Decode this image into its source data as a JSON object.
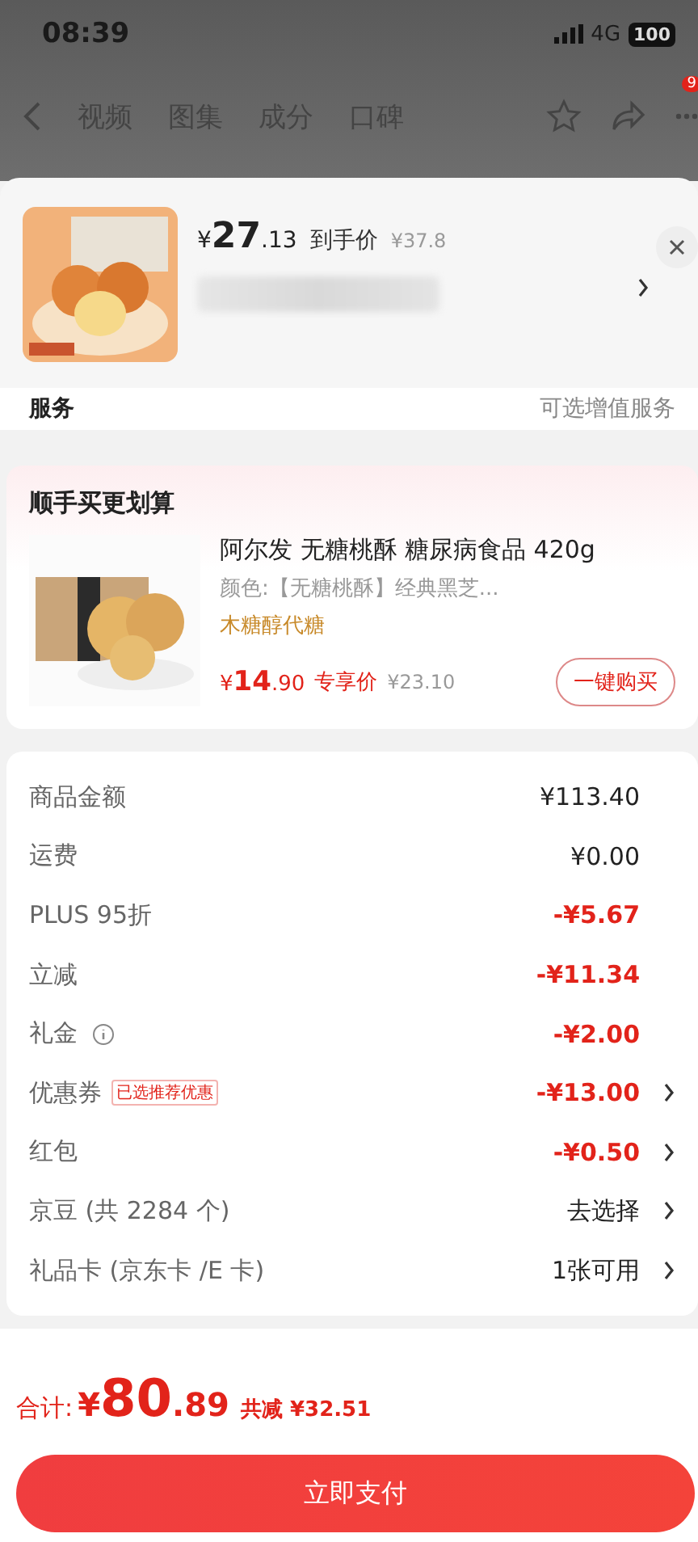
{
  "status_bar": {
    "time": "08:39",
    "network": "4G",
    "battery": "100"
  },
  "nav": {
    "tabs": [
      "视频",
      "图集",
      "成分",
      "口碑"
    ],
    "badge": "9"
  },
  "product_popup": {
    "price_symbol": "¥",
    "price_int": "27",
    "price_dec": ".13",
    "price_label": "到手价",
    "original_price": "¥37.8"
  },
  "service_row": {
    "label": "服务",
    "value": "可选增值服务"
  },
  "bundle": {
    "title": "顺手买更划算",
    "name": "阿尔发 无糖桃酥 糖尿病食品 420g",
    "spec": "颜色:【无糖桃酥】经典黑芝...",
    "tag": "木糖醇代糖",
    "price_symbol": "¥",
    "price_int": "14",
    "price_dec": ".90",
    "price_label": "专享价",
    "original_price": "¥23.10",
    "button": "一键购买"
  },
  "summary": [
    {
      "label": "商品金额",
      "value": "¥113.40",
      "negative": false,
      "chevron": false,
      "info": false
    },
    {
      "label": "运费",
      "value": "¥0.00",
      "negative": false,
      "chevron": false,
      "info": false
    },
    {
      "label": "PLUS 95折",
      "value": "-¥5.67",
      "negative": true,
      "chevron": false,
      "info": false
    },
    {
      "label": "立减",
      "value": "-¥11.34",
      "negative": true,
      "chevron": false,
      "info": false
    },
    {
      "label": "礼金",
      "value": "-¥2.00",
      "negative": true,
      "chevron": false,
      "info": true
    },
    {
      "label": "优惠券",
      "tag": "已选推荐优惠",
      "value": "-¥13.00",
      "negative": true,
      "chevron": true,
      "info": false
    },
    {
      "label": "红包",
      "value": "-¥0.50",
      "negative": true,
      "chevron": true,
      "info": false
    },
    {
      "label": "京豆 (共 2284 个)",
      "value": "去选择",
      "negative": false,
      "chevron": true,
      "info": false
    },
    {
      "label": "礼品卡 (京东卡 /E 卡)",
      "value": "1张可用",
      "negative": false,
      "chevron": true,
      "info": false
    }
  ],
  "footer": {
    "total_label": "合计:",
    "symbol": "¥",
    "total_int": "80",
    "total_dec": ".89",
    "saved": "共减 ¥32.51",
    "pay_button": "立即支付"
  }
}
